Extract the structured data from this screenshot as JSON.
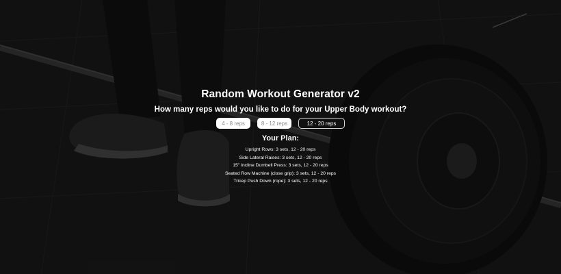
{
  "app": {
    "title": "Random Workout Generator v2",
    "question": "How many reps would you like to do for your Upper Body workout?"
  },
  "rep_options": [
    {
      "label": "4 - 8 reps",
      "selected": false
    },
    {
      "label": "8 - 12 reps",
      "selected": false
    },
    {
      "label": "12 - 20 reps",
      "selected": true
    }
  ],
  "plan": {
    "heading": "Your Plan:",
    "items": [
      "Upright Rows: 3 sets, 12 - 20 reps",
      "Side Lateral Raises: 3 sets, 12 - 20 reps",
      "15\" Incline Dumbell Press: 3 sets, 12 - 20 reps",
      "Seated Row Machine (close grip): 3 sets, 12 - 20 reps",
      "Tricep Push Down (rope): 3 sets, 12 - 20 reps"
    ]
  },
  "colors": {
    "background": "#161616",
    "text": "#ffffff",
    "button_light_bg": "#ffffff",
    "button_light_text": "#8a8a8a",
    "button_active_bg": "#111111",
    "button_active_border": "#d8d8d8"
  }
}
